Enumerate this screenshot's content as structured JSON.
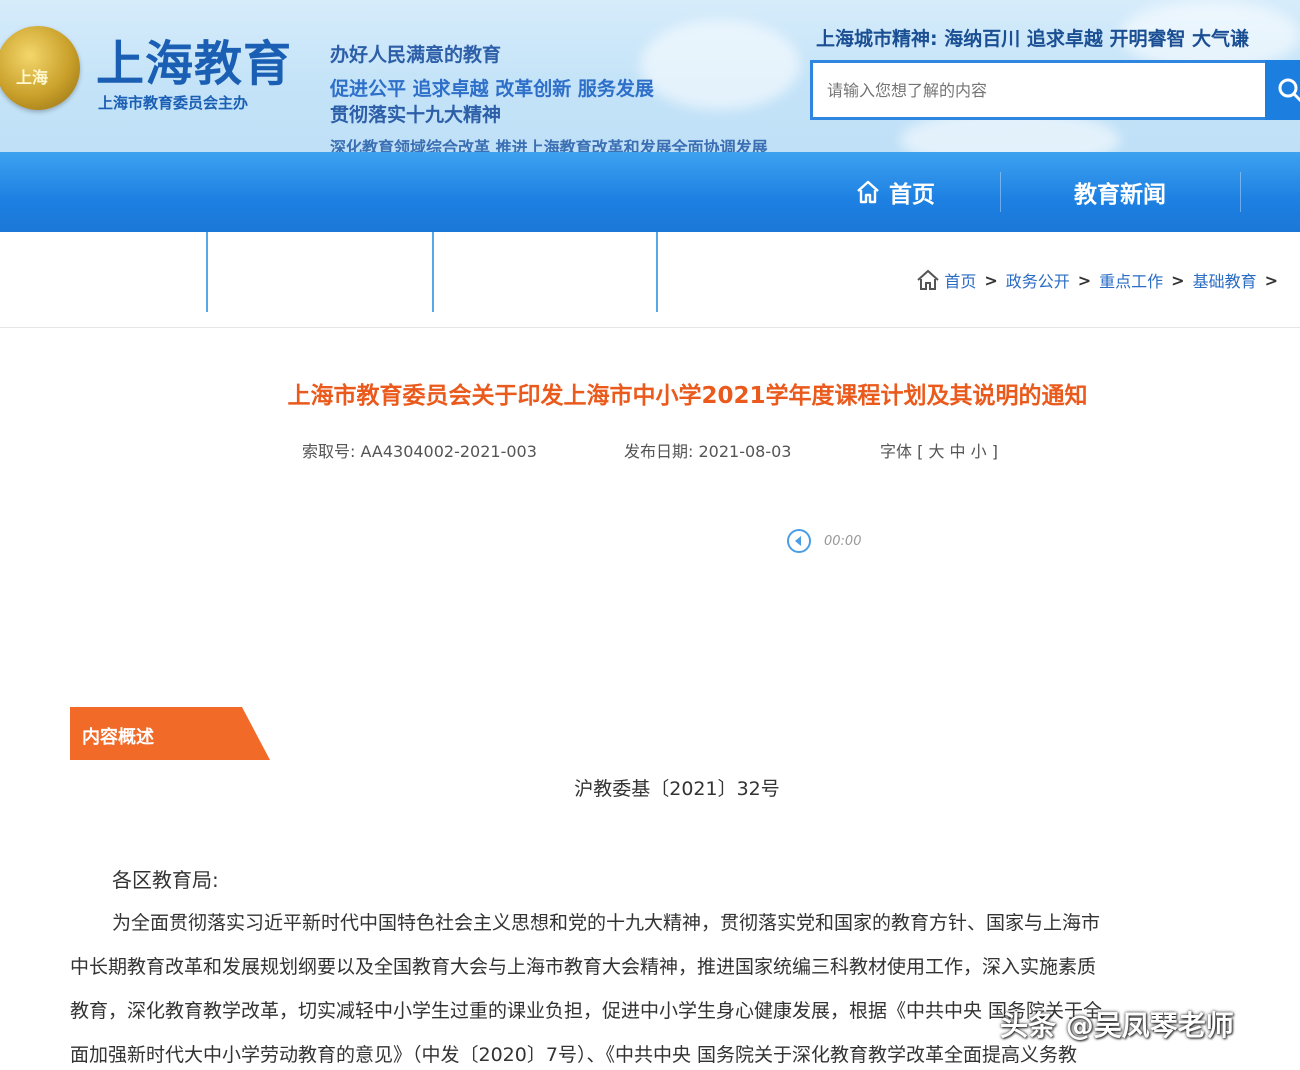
{
  "header": {
    "site_title": "上海教育",
    "site_subtitle": "上海市教育委员会主办",
    "emblem_text": "上海",
    "slogans": [
      "办好人民满意的教育",
      "促进公平 追求卓越 改革创新 服务发展",
      "贯彻落实十九大精神",
      "深化教育领域综合改革 推进上海教育改革和发展全面协调发展"
    ],
    "city_spirit": "上海城市精神: 海纳百川 追求卓越 开明睿智 大气谦",
    "search": {
      "placeholder": "请输入您想了解的内容"
    }
  },
  "nav": {
    "items": [
      {
        "label": "首页"
      },
      {
        "label": "教育新闻"
      }
    ]
  },
  "breadcrumb": {
    "items": [
      "首页",
      "政务公开",
      "重点工作",
      "基础教育"
    ],
    "separator": ">"
  },
  "article": {
    "title": "上海市教育委员会关于印发上海市中小学2021学年度课程计划及其说明的通知",
    "index_label": "索取号:",
    "index_value": "AA4304002-2021-003",
    "date_label": "发布日期:",
    "date_value": "2021-08-03",
    "font_label": "字体",
    "font_options": "[ 大 中 小 ]",
    "audio_time": "00:00",
    "summary_tag": "内容概述",
    "doc_number": "沪教委基〔2021〕32号",
    "salutation": "各区教育局:",
    "body_lines": [
      "为全面贯彻落实习近平新时代中国特色社会主义思想和党的十九大精神，贯彻落实党和国家的教育方针、国家与上海市",
      "中长期教育改革和发展规划纲要以及全国教育大会与上海市教育大会精神，推进国家统编三科教材使用工作，深入实施素质",
      "教育，深化教育教学改革，切实减轻中小学生过重的课业负担，促进中小学生身心健康发展，根据《中共中央 国务院关于全",
      "面加强新时代大中小学劳动教育的意见》（中发〔2020〕7号）、《中共中央 国务院关于深化教育教学改革全面提高义务教"
    ]
  },
  "watermark": "头条 @吴凤琴老师",
  "colors": {
    "nav_blue": "#1d80e2",
    "title_orange": "#ea5a1c",
    "tag_orange": "#f26a28",
    "link_blue": "#2a6cc4"
  }
}
